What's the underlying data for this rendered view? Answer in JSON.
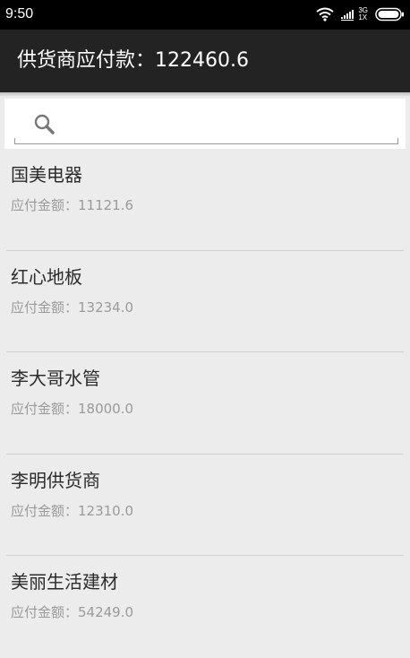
{
  "status_bar": {
    "time": "9:50",
    "network_top": "3G",
    "network_bottom": "1X"
  },
  "header": {
    "title": "供货商应付款：122460.6"
  },
  "search": {
    "placeholder": "",
    "value": ""
  },
  "suppliers": [
    {
      "name": "国美电器",
      "amount": "应付金额：11121.6"
    },
    {
      "name": "红心地板",
      "amount": "应付金额：13234.0"
    },
    {
      "name": "李大哥水管",
      "amount": "应付金额：18000.0"
    },
    {
      "name": "李明供货商",
      "amount": "应付金额：12310.0"
    },
    {
      "name": "美丽生活建材",
      "amount": "应付金额：54249.0"
    }
  ],
  "colors": {
    "status_bar": "#000000",
    "action_bar": "#232323",
    "background": "#ececec",
    "primary_text": "#2b2b2b",
    "secondary_text": "#9a9a9a"
  }
}
